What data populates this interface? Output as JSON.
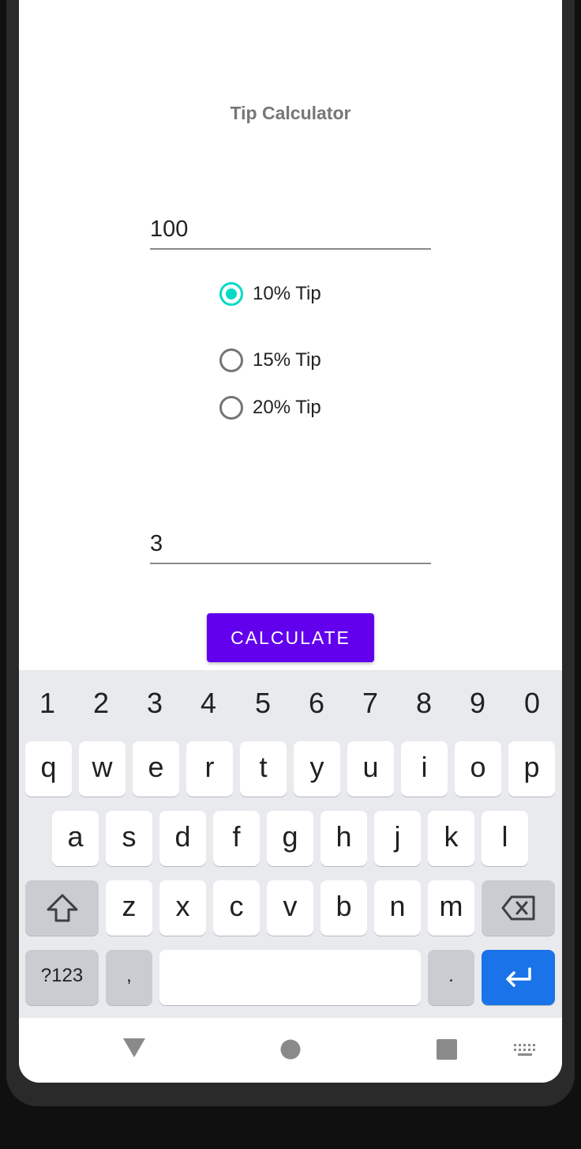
{
  "app": {
    "title": "Tip Calculator"
  },
  "form": {
    "bill_amount": "100",
    "tip_options": [
      {
        "label": "10% Tip",
        "checked": true
      },
      {
        "label": "15% Tip",
        "checked": false
      },
      {
        "label": "20% Tip",
        "checked": false
      }
    ],
    "people_count": "3",
    "calculate_label": "CALCULATE"
  },
  "keyboard": {
    "number_row": [
      "1",
      "2",
      "3",
      "4",
      "5",
      "6",
      "7",
      "8",
      "9",
      "0"
    ],
    "row1": [
      "q",
      "w",
      "e",
      "r",
      "t",
      "y",
      "u",
      "i",
      "o",
      "p"
    ],
    "row2": [
      "a",
      "s",
      "d",
      "f",
      "g",
      "h",
      "j",
      "k",
      "l"
    ],
    "row3": [
      "z",
      "x",
      "c",
      "v",
      "b",
      "n",
      "m"
    ],
    "symbols_label": "?123",
    "comma_label": ",",
    "period_label": ".",
    "shift_icon": "shift-icon",
    "backspace_icon": "backspace-icon",
    "enter_icon": "enter-icon"
  },
  "navbar": {
    "back_icon": "back-triangle-icon",
    "home_icon": "home-circle-icon",
    "recents_icon": "recents-square-icon",
    "keyboard_icon": "keyboard-switch-icon"
  },
  "colors": {
    "accent": "#6200ee",
    "radio_checked": "#03dac5",
    "enter_key": "#1a73e8"
  }
}
